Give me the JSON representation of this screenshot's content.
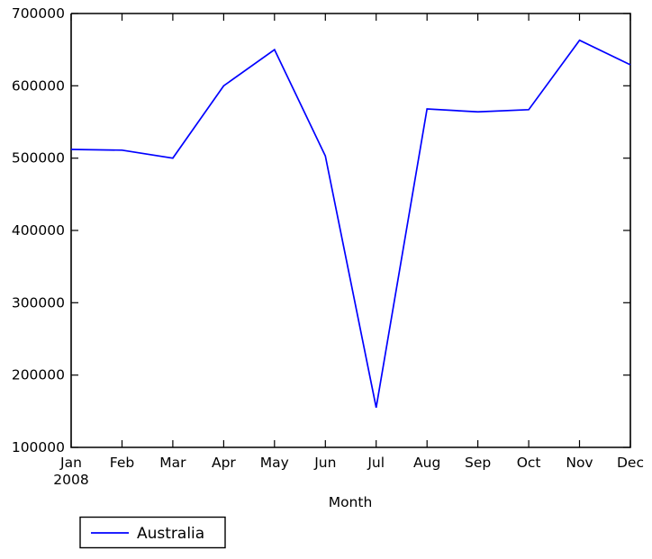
{
  "chart_data": {
    "type": "line",
    "title": "",
    "xlabel": "Month",
    "ylabel": "",
    "categories": [
      "Jan",
      "Feb",
      "Mar",
      "Apr",
      "May",
      "Jun",
      "Jul",
      "Aug",
      "Sep",
      "Oct",
      "Nov",
      "Dec"
    ],
    "x_sublabel": "2008",
    "series": [
      {
        "name": "Australia",
        "color": "#0000ff",
        "values": [
          512000,
          511000,
          500000,
          600000,
          650000,
          503000,
          155000,
          568000,
          564000,
          567000,
          663000,
          629000
        ]
      }
    ],
    "xlim": [
      0,
      11
    ],
    "ylim": [
      100000,
      700000
    ],
    "yticks": [
      100000,
      200000,
      300000,
      400000,
      500000,
      600000,
      700000
    ],
    "ytick_labels": [
      "100000",
      "200000",
      "300000",
      "400000",
      "500000",
      "600000",
      "700000"
    ],
    "grid": false,
    "legend_position": "below-left"
  },
  "legend": {
    "entries": [
      {
        "label": "Australia",
        "color": "#0000ff"
      }
    ]
  },
  "axes": {
    "x_axis_title": "Month",
    "x_year_label": "2008"
  }
}
